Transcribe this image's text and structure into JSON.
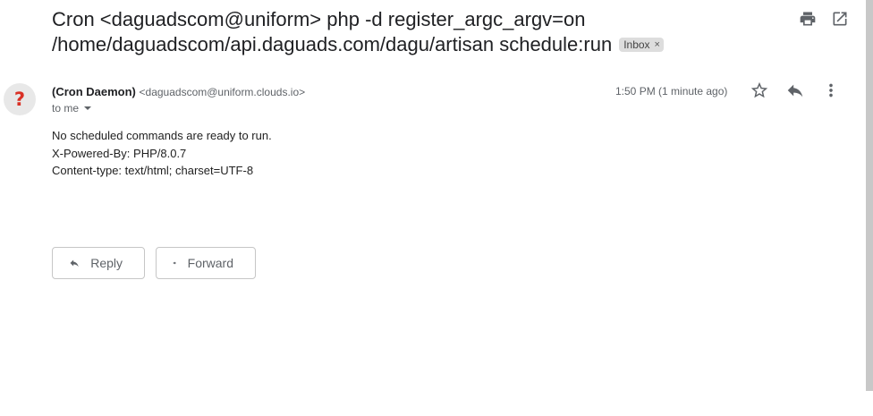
{
  "email": {
    "subject_line1": "Cron <daguadscom@uniform> php -d register_argc_argv=on",
    "subject_line2": "/home/daguadscom/api.daguads.com/dagu/artisan schedule:run",
    "label_chip": "Inbox",
    "label_remove": "×",
    "avatar_glyph": "?",
    "sender_name": "(Cron Daemon)",
    "sender_email": "<daguadscom@uniform.clouds.io>",
    "recipient": "to me",
    "timestamp": "1:50 PM (1 minute ago)",
    "body_lines": [
      "No scheduled commands are ready to run.",
      "X-Powered-By: PHP/8.0.7",
      "Content-type: text/html; charset=UTF-8"
    ]
  },
  "actions": {
    "reply_label": "Reply",
    "forward_label": "Forward"
  },
  "icons": {
    "print": "print-icon",
    "open_new_window": "open-in-new-window-icon",
    "star": "star-icon",
    "reply": "reply-icon",
    "more": "more-vert-icon",
    "forward": "forward-icon"
  },
  "colors": {
    "avatar_glyph": "#d93025",
    "chip_bg": "#dddddd",
    "icon": "#5f6368"
  }
}
